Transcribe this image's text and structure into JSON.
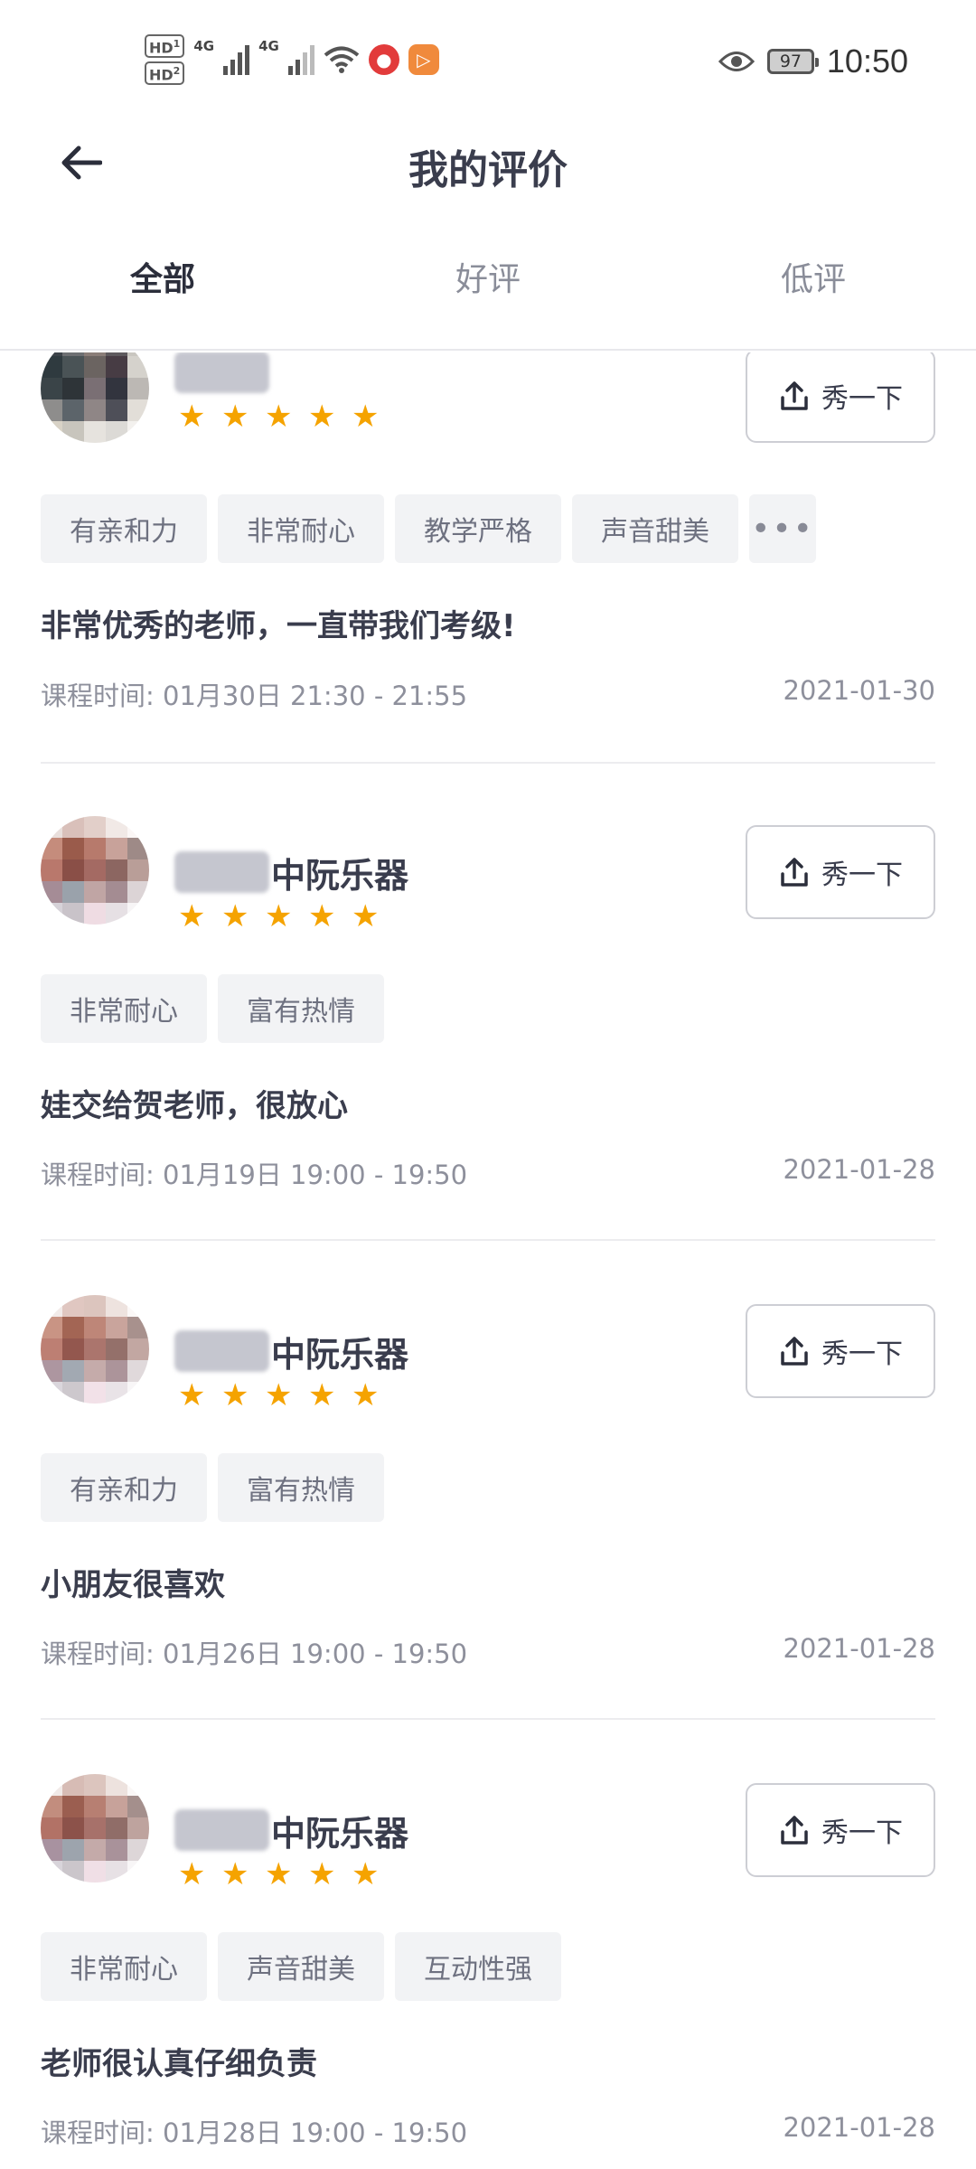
{
  "status_bar": {
    "hd1": "HD",
    "hd1_sub": "1",
    "hd2": "HD",
    "hd2_sub": "2",
    "net1": "4G",
    "net2": "4G",
    "battery": "97",
    "time": "10:50"
  },
  "header": {
    "title": "我的评价"
  },
  "tabs": [
    {
      "label": "全部",
      "active": true
    },
    {
      "label": "好评",
      "active": false
    },
    {
      "label": "低评",
      "active": false
    }
  ],
  "share_label": "秀一下",
  "more_label": "•••",
  "time_label": "课程时间: ",
  "accent_color": "#f5a300",
  "reviews": [
    {
      "name": "",
      "stars": 5,
      "tags": [
        "有亲和力",
        "非常耐心",
        "教学严格",
        "声音甜美"
      ],
      "has_more": true,
      "comment": "非常优秀的老师，一直带我们考级!",
      "course_time": "01月30日 21:30 - 21:55",
      "date": "2021-01-30"
    },
    {
      "name": "中阮乐器",
      "stars": 5,
      "tags": [
        "非常耐心",
        "富有热情"
      ],
      "has_more": false,
      "comment": "娃交给贺老师，很放心",
      "course_time": "01月19日 19:00 - 19:50",
      "date": "2021-01-28"
    },
    {
      "name": "中阮乐器",
      "stars": 5,
      "tags": [
        "有亲和力",
        "富有热情"
      ],
      "has_more": false,
      "comment": "小朋友很喜欢",
      "course_time": "01月26日 19:00 - 19:50",
      "date": "2021-01-28"
    },
    {
      "name": "中阮乐器",
      "stars": 5,
      "tags": [
        "非常耐心",
        "声音甜美",
        "互动性强"
      ],
      "has_more": false,
      "comment": "老师很认真仔细负责",
      "course_time": "01月28日 19:00 - 19:50",
      "date": "2021-01-28"
    }
  ]
}
